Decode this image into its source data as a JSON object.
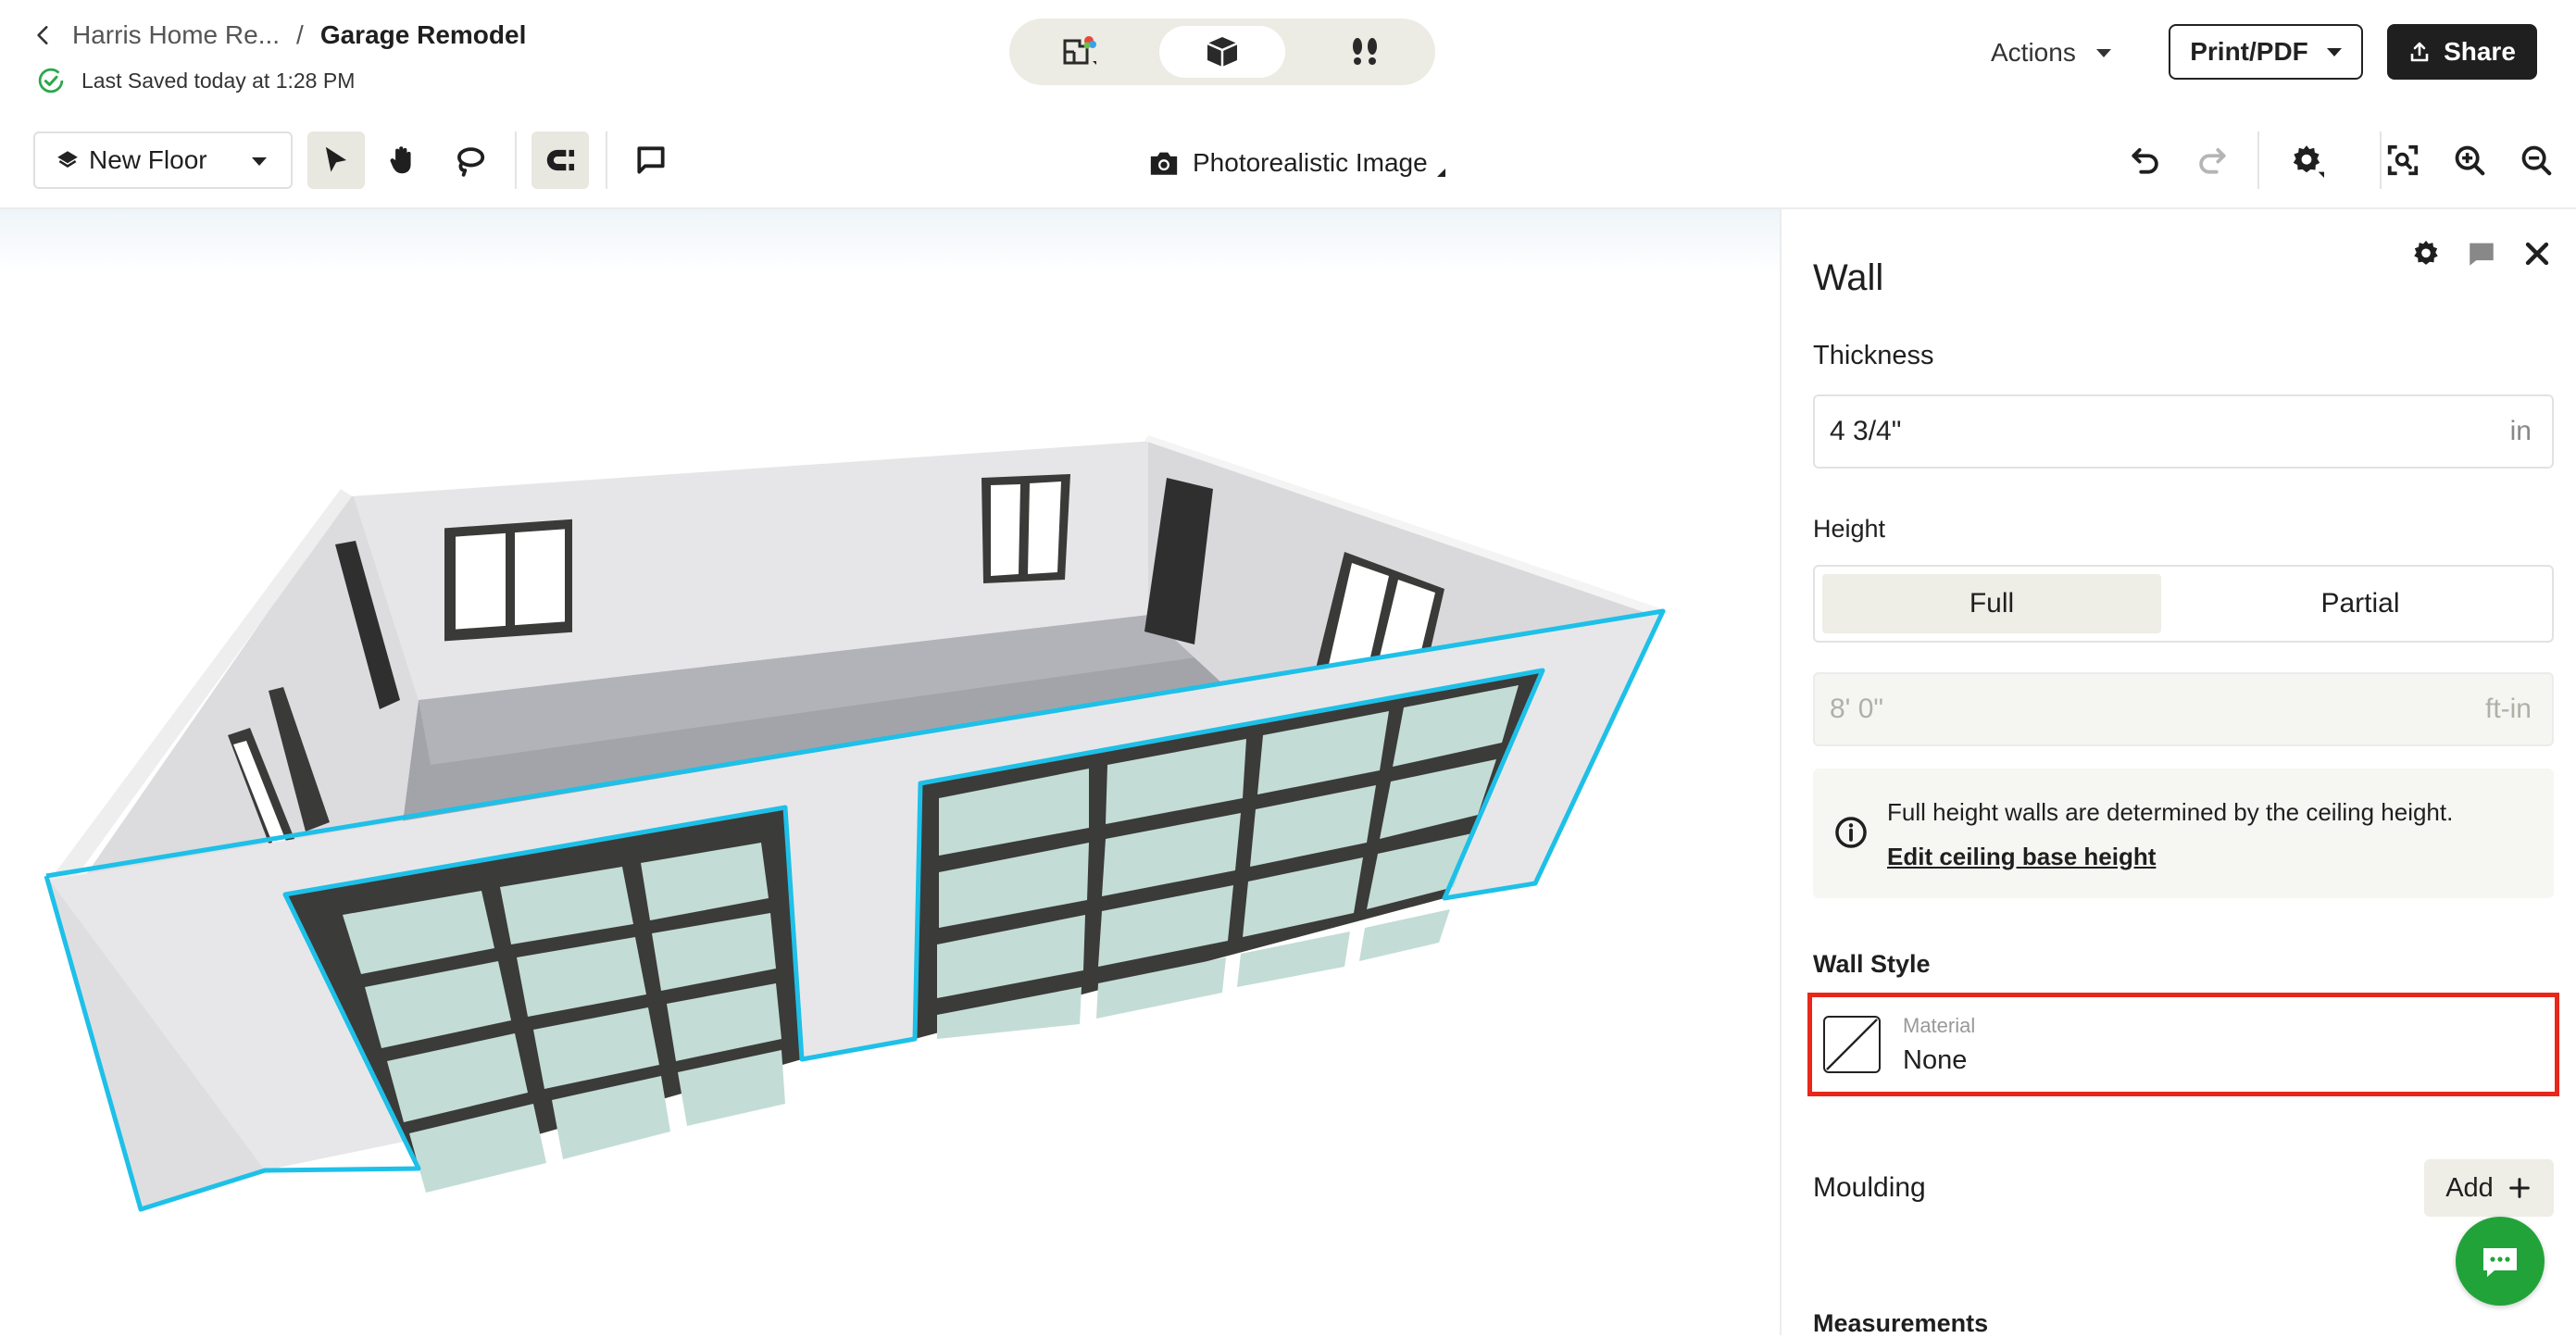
{
  "header": {
    "breadcrumb_parent": "Harris Home Re...",
    "breadcrumb_separator": "/",
    "breadcrumb_current": "Garage Remodel",
    "saved_status": "Last Saved today at 1:28 PM",
    "view_modes": [
      {
        "icon": "floorplan-2d-icon",
        "active": false
      },
      {
        "icon": "cube-3d-icon",
        "active": true
      },
      {
        "icon": "footsteps-icon",
        "active": false
      }
    ],
    "actions_label": "Actions",
    "print_label": "Print/PDF",
    "share_label": "Share"
  },
  "toolbar": {
    "floor_label": "New Floor",
    "photo_label": "Photorealistic Image",
    "tools": [
      "select-arrow-icon",
      "hand-pan-icon",
      "lasso-icon",
      "magnet-icon",
      "comment-icon"
    ],
    "right_tools": [
      "undo-icon",
      "redo-icon",
      "settings-icon",
      "fit-view-icon",
      "zoom-in-icon",
      "zoom-out-icon"
    ]
  },
  "panel": {
    "title": "Wall",
    "thickness_label": "Thickness",
    "thickness_value": "4 3/4\"",
    "thickness_unit": "in",
    "height_label": "Height",
    "height_options": [
      "Full",
      "Partial"
    ],
    "height_selected": "Full",
    "height_value": "8' 0\"",
    "height_unit": "ft-in",
    "info_text": "Full height walls are determined by the ceiling height.",
    "info_link": "Edit ceiling base height",
    "wall_style_label": "Wall Style",
    "material_label": "Material",
    "material_value": "None",
    "moulding_label": "Moulding",
    "add_label": "Add",
    "measurements_label": "Measurements"
  },
  "colors": {
    "selection_outline": "#1ec0e8",
    "highlight_box": "#e8271b",
    "chat_button": "#22a33a",
    "primary_dark": "#1f1f1f"
  }
}
